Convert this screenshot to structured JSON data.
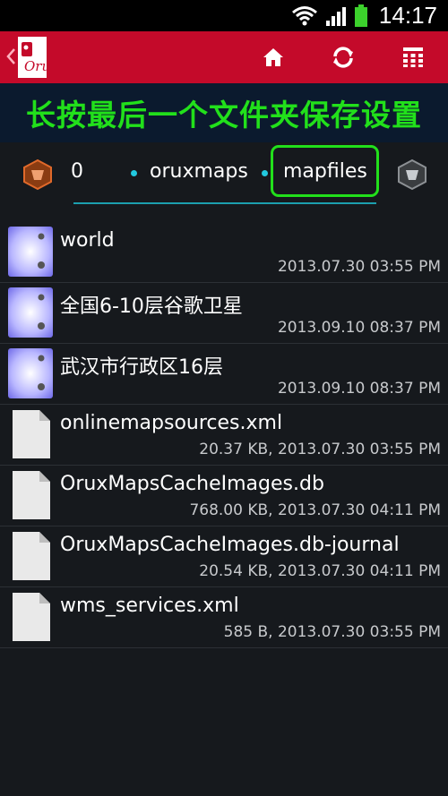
{
  "status_bar": {
    "time": "14:17",
    "icons": [
      "wifi-icon",
      "signal-icon",
      "battery-icon"
    ],
    "battery_color": "#3cd12c"
  },
  "action_bar": {
    "background": "#c40a2a",
    "logo_text": "Oru",
    "icons": [
      "home-icon",
      "refresh-icon",
      "grid-menu-icon"
    ]
  },
  "banner": {
    "text": "长按最后一个文件夹保存设置",
    "color": "#22e01b"
  },
  "breadcrumb": {
    "items": [
      {
        "label": "0"
      },
      {
        "label": "oruxmaps"
      },
      {
        "label": "mapfiles"
      }
    ],
    "left_nav_icon": "orange-cube-icon",
    "right_nav_icon": "gray-cube-icon",
    "highlight_color": "#22e01b",
    "accent": "#22c9e0"
  },
  "files": [
    {
      "name": "world",
      "meta": "2013.07.30 03:55 PM",
      "icon": "folder-icon"
    },
    {
      "name": "全国6-10层谷歌卫星",
      "meta": "2013.09.10 08:37 PM",
      "icon": "folder-icon"
    },
    {
      "name": "武汉市行政区16层",
      "meta": "2013.09.10 08:37 PM",
      "icon": "folder-icon"
    },
    {
      "name": "onlinemapsources.xml",
      "meta": "20.37 KB, 2013.07.30 03:55 PM",
      "icon": "file-icon"
    },
    {
      "name": "OruxMapsCacheImages.db",
      "meta": "768.00 KB, 2013.07.30 04:11 PM",
      "icon": "file-icon"
    },
    {
      "name": "OruxMapsCacheImages.db-journal",
      "meta": "20.54 KB, 2013.07.30 04:11 PM",
      "icon": "file-icon"
    },
    {
      "name": "wms_services.xml",
      "meta": "585 B, 2013.07.30 03:55 PM",
      "icon": "file-icon"
    }
  ]
}
